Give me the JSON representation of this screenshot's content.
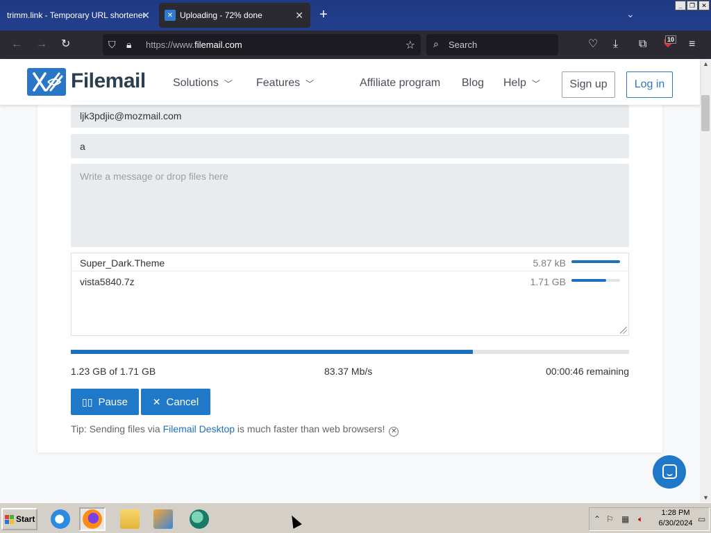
{
  "browser": {
    "tabs": [
      {
        "title": "trimm.link - Temporary URL shortener",
        "active": false
      },
      {
        "title": "Uploading - 72% done",
        "active": true
      }
    ],
    "url_prefix": "https://www.",
    "url_domain": "filemail.com",
    "search_placeholder": "Search",
    "extension_badge": "10"
  },
  "site": {
    "logo_text": "Filemail",
    "menu": {
      "solutions": "Solutions",
      "features": "Features",
      "affiliate": "Affiliate program",
      "blog": "Blog",
      "help": "Help"
    },
    "signup_label": "Sign up",
    "login_label": "Log in"
  },
  "form": {
    "email_value": "ljk3pdjic@mozmail.com",
    "subject_value": "a",
    "message_placeholder": "Write a message or drop files here"
  },
  "files": [
    {
      "name": "Super_Dark.Theme",
      "size": "5.87 kB",
      "progress": 1.0
    },
    {
      "name": "vista5840.7z",
      "size": "1.71 GB",
      "progress": 0.72
    }
  ],
  "upload": {
    "progress": 0.72,
    "transferred": "1.23 GB of 1.71 GB",
    "speed": "83.37 Mb/s",
    "remaining": "00:00:46 remaining",
    "pause_label": "Pause",
    "cancel_label": "Cancel"
  },
  "tip": {
    "prefix": "Tip: Sending files via ",
    "link": "Filemail Desktop",
    "suffix": " is much faster than web browsers!"
  },
  "taskbar": {
    "start_label": "Start",
    "time": "1:28 PM",
    "date": "6/30/2024"
  },
  "colors": {
    "accent": "#1f78c8",
    "tabstrip": "#1f3a83",
    "toolbar": "#2b2a33"
  }
}
